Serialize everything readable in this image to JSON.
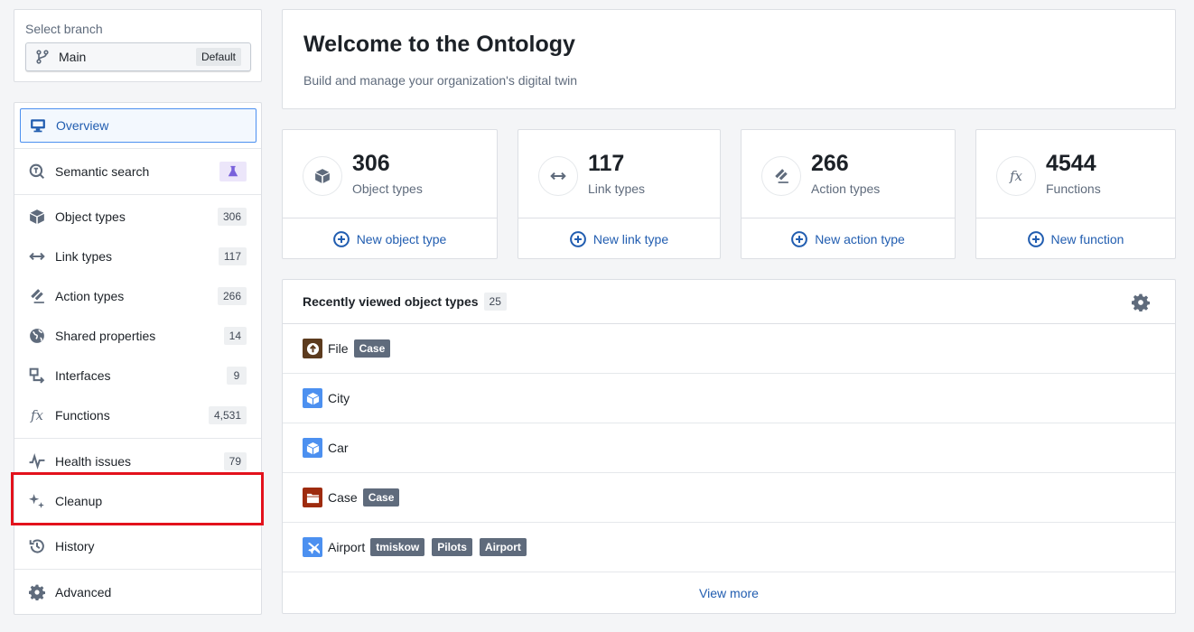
{
  "branch": {
    "label": "Select branch",
    "name": "Main",
    "tag": "Default"
  },
  "sidebar": {
    "items": [
      {
        "label": "Overview",
        "icon": "desktop-icon",
        "active": true
      },
      {
        "label": "Semantic search",
        "icon": "semantic-search-icon",
        "badge_icon": "beaker-icon"
      },
      {
        "label": "Object types",
        "icon": "cube-icon",
        "count": "306"
      },
      {
        "label": "Link types",
        "icon": "arrows-horizontal-icon",
        "count": "117"
      },
      {
        "label": "Action types",
        "icon": "action-icon",
        "count": "266"
      },
      {
        "label": "Shared properties",
        "icon": "globe-icon",
        "count": "14"
      },
      {
        "label": "Interfaces",
        "icon": "interface-icon",
        "count": "9"
      },
      {
        "label": "Functions",
        "icon": "function-icon",
        "count": "4,531"
      },
      {
        "label": "Health issues",
        "icon": "pulse-icon",
        "count": "79"
      },
      {
        "label": "Cleanup",
        "icon": "sparkles-icon",
        "highlighted": true
      },
      {
        "label": "History",
        "icon": "history-icon"
      },
      {
        "label": "Advanced",
        "icon": "cog-icon"
      }
    ]
  },
  "welcome": {
    "title": "Welcome to the Ontology",
    "subtitle": "Build and manage your organization's digital twin"
  },
  "stats": [
    {
      "value": "306",
      "label": "Object types",
      "action": "New object type",
      "icon": "cube-icon"
    },
    {
      "value": "117",
      "label": "Link types",
      "action": "New link type",
      "icon": "arrows-horizontal-icon"
    },
    {
      "value": "266",
      "label": "Action types",
      "action": "New action type",
      "icon": "action-icon"
    },
    {
      "value": "4544",
      "label": "Functions",
      "action": "New function",
      "icon": "function-icon"
    }
  ],
  "recent": {
    "title": "Recently viewed object types",
    "count": "25",
    "items": [
      {
        "name": "File",
        "icon": "upload-icon",
        "color": "#5c3b1e",
        "tags": [
          "Case"
        ]
      },
      {
        "name": "City",
        "icon": "cube-icon",
        "color": "#4c90f0",
        "tags": []
      },
      {
        "name": "Car",
        "icon": "cube-icon",
        "color": "#4c90f0",
        "tags": []
      },
      {
        "name": "Case",
        "icon": "folder-icon",
        "color": "#9e2b0e",
        "tags": [
          "Case"
        ]
      },
      {
        "name": "Airport",
        "icon": "airplane-icon",
        "color": "#4c90f0",
        "tags": [
          "tmiskow",
          "Pilots",
          "Airport"
        ]
      }
    ],
    "view_more": "View more"
  },
  "colors": {
    "accent": "#215db0",
    "highlight": "#e3121c",
    "tag_bg": "#5f6b7c"
  }
}
